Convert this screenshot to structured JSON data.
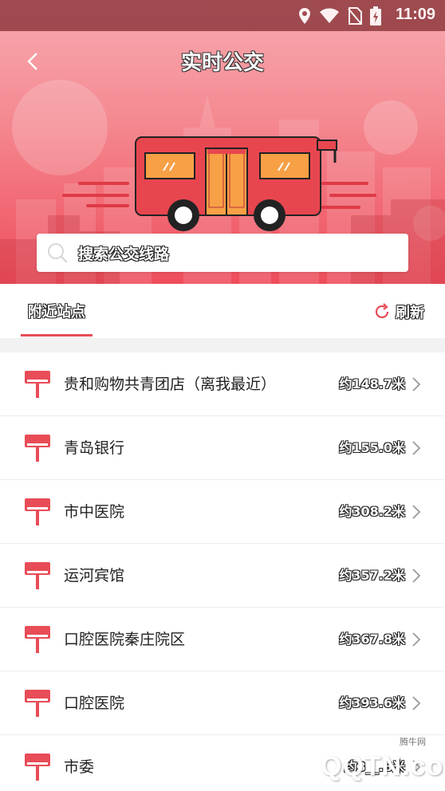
{
  "status_bar": {
    "time": "11:09",
    "icons": [
      "location-icon",
      "wifi-icon",
      "no-sim-icon",
      "battery-charging-icon"
    ]
  },
  "header": {
    "title": "实时公交",
    "back_icon": "chevron-left-icon"
  },
  "search": {
    "placeholder": "搜索公交线路",
    "icon": "search-icon"
  },
  "tabs": {
    "nearby_label": "附近站点",
    "refresh_label": "刷新",
    "refresh_icon": "refresh-icon"
  },
  "stops": [
    {
      "name": "贵和购物共青团店（离我最近）",
      "distance": "约148.7米"
    },
    {
      "name": "青岛银行",
      "distance": "约155.0米"
    },
    {
      "name": "市中医院",
      "distance": "约308.2米"
    },
    {
      "name": "运河宾馆",
      "distance": "约357.2米"
    },
    {
      "name": "口腔医院秦庄院区",
      "distance": "约367.8米"
    },
    {
      "name": "口腔医院",
      "distance": "约393.6米"
    },
    {
      "name": "市委",
      "distance": "约3__.8米"
    }
  ],
  "watermark": {
    "text": "QQTN.com",
    "small": "腾牛网"
  },
  "colors": {
    "accent": "#e84c57",
    "hero_top": "#f7aab0",
    "hero_bottom": "#ee4d5b",
    "bus_body": "#e8464f",
    "bus_window": "#f7a046"
  }
}
